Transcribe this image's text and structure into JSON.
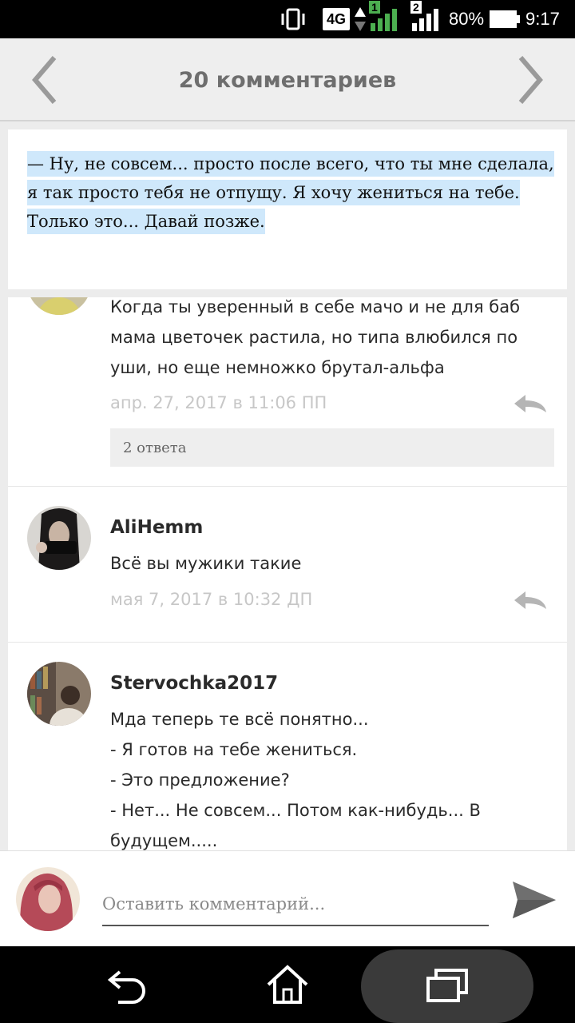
{
  "status_bar": {
    "network": "4G",
    "signal_1_label": "1",
    "signal_2_label": "2",
    "battery": "80%",
    "time": "9:17"
  },
  "header": {
    "title": "20 комментариев",
    "prev_icon": "chevron-left-icon",
    "next_icon": "chevron-right-icon"
  },
  "quote": {
    "text": "— Ну, не совсем... просто после всего, что ты мне сделала, я так просто тебя не отпущу. Я хочу жениться на тебе. Только это... Давай позже."
  },
  "comments": [
    {
      "author": "",
      "text": "Когда ты уверенный в себе мачо и не для баб мама цветочек растила, но типа влюбился по уши, но еще немножко брутал-альфа",
      "time": "апр. 27, 2017 в 11:06 ПП",
      "replies": "2 ответа"
    },
    {
      "author": "AliHemm",
      "text": "Всё вы мужики такие",
      "time": "мая 7, 2017 в 10:32 ДП"
    },
    {
      "author": "Stervochka2017",
      "lines": [
        "Мда теперь те всё понятно...",
        "- Я готов на тебе жениться.",
        "- Это предложение?",
        "- Нет... Не совсем... Потом как-нибудь... В будущем....."
      ]
    }
  ],
  "composer": {
    "placeholder": "Оставить комментарий...",
    "send_icon": "send-icon"
  },
  "navbar": {
    "back_icon": "back-icon",
    "home_icon": "home-icon",
    "recents_icon": "recents-icon"
  },
  "colors": {
    "highlight": "#cfe8fb",
    "header_bg": "#eeeeee",
    "muted_text": "#c7c7c7"
  }
}
